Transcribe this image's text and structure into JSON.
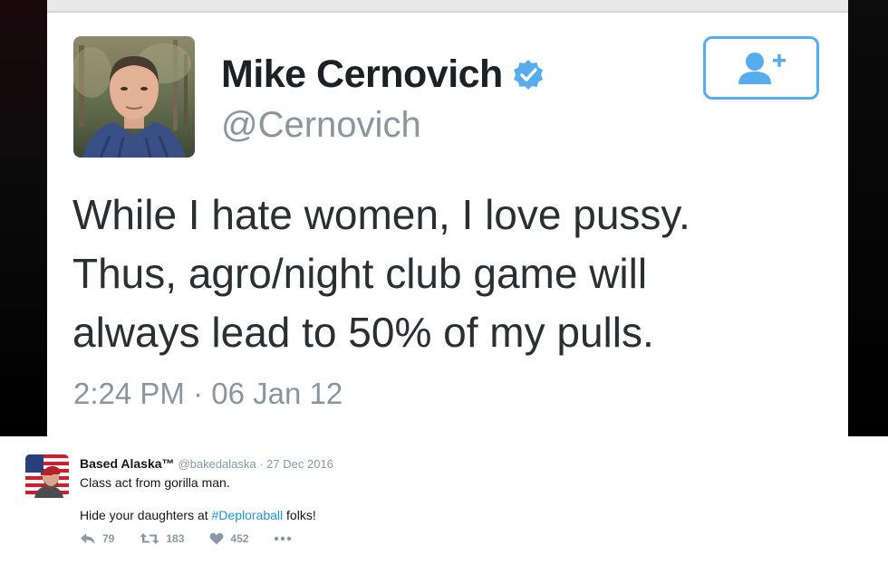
{
  "embedded_tweet": {
    "display_name": "Mike Cernovich",
    "handle": "@Cernovich",
    "text_lines": [
      "While I hate women, I love pussy.",
      "Thus, agro/night club game will",
      "always lead to 50% of my pulls."
    ],
    "timestamp": "2:24 PM · 06 Jan 12",
    "icons": {
      "verified": "verified-badge-icon",
      "follow": "add-user-icon"
    }
  },
  "quote_tweet": {
    "display_name": "Based Alaska™",
    "handle_date": "@bakedalaska · 27 Dec 2016",
    "line1": "Class act from gorilla man.",
    "line2_before": "Hide your daughters at ",
    "hashtag": "#Deploraball",
    "line2_after": " folks!",
    "actions": {
      "reply_count": "79",
      "retweet_count": "183",
      "like_count": "452"
    }
  },
  "colors": {
    "twitter_blue": "#55acee",
    "link_blue": "#1b95e0",
    "grey_text": "#8a959e",
    "meta_grey": "#8899a6"
  }
}
